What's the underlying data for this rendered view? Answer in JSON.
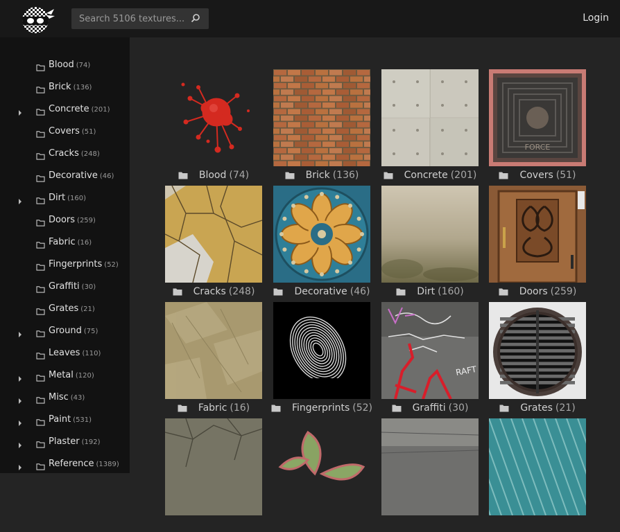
{
  "header": {
    "search_placeholder": "Search 5106 textures...",
    "login_label": "Login",
    "logo_icon": "ninja-checker-logo-icon"
  },
  "sidebar": {
    "items": [
      {
        "label": "Blood",
        "count": "(74)",
        "expandable": false
      },
      {
        "label": "Brick",
        "count": "(136)",
        "expandable": false
      },
      {
        "label": "Concrete",
        "count": "(201)",
        "expandable": true
      },
      {
        "label": "Covers",
        "count": "(51)",
        "expandable": false
      },
      {
        "label": "Cracks",
        "count": "(248)",
        "expandable": false
      },
      {
        "label": "Decorative",
        "count": "(46)",
        "expandable": false
      },
      {
        "label": "Dirt",
        "count": "(160)",
        "expandable": true
      },
      {
        "label": "Doors",
        "count": "(259)",
        "expandable": false
      },
      {
        "label": "Fabric",
        "count": "(16)",
        "expandable": false
      },
      {
        "label": "Fingerprints",
        "count": "(52)",
        "expandable": false
      },
      {
        "label": "Graffiti",
        "count": "(30)",
        "expandable": false
      },
      {
        "label": "Grates",
        "count": "(21)",
        "expandable": false
      },
      {
        "label": "Ground",
        "count": "(75)",
        "expandable": true
      },
      {
        "label": "Leaves",
        "count": "(110)",
        "expandable": false
      },
      {
        "label": "Metal",
        "count": "(120)",
        "expandable": true
      },
      {
        "label": "Misc",
        "count": "(43)",
        "expandable": true
      },
      {
        "label": "Paint",
        "count": "(531)",
        "expandable": true
      },
      {
        "label": "Plaster",
        "count": "(192)",
        "expandable": true
      },
      {
        "label": "Reference",
        "count": "(1389)",
        "expandable": true
      }
    ]
  },
  "grid": {
    "tiles": [
      {
        "label": "Blood",
        "count": "(74)",
        "texture": "blood"
      },
      {
        "label": "Brick",
        "count": "(136)",
        "texture": "brick"
      },
      {
        "label": "Concrete",
        "count": "(201)",
        "texture": "concrete"
      },
      {
        "label": "Covers",
        "count": "(51)",
        "texture": "covers"
      },
      {
        "label": "Cracks",
        "count": "(248)",
        "texture": "cracks"
      },
      {
        "label": "Decorative",
        "count": "(46)",
        "texture": "decorative"
      },
      {
        "label": "Dirt",
        "count": "(160)",
        "texture": "dirt"
      },
      {
        "label": "Doors",
        "count": "(259)",
        "texture": "doors"
      },
      {
        "label": "Fabric",
        "count": "(16)",
        "texture": "fabric"
      },
      {
        "label": "Fingerprints",
        "count": "(52)",
        "texture": "fingerprints"
      },
      {
        "label": "Graffiti",
        "count": "(30)",
        "texture": "graffiti"
      },
      {
        "label": "Grates",
        "count": "(21)",
        "texture": "grates"
      },
      {
        "label": "",
        "count": "",
        "texture": "ground"
      },
      {
        "label": "",
        "count": "",
        "texture": "leaves"
      },
      {
        "label": "",
        "count": "",
        "texture": "metal"
      },
      {
        "label": "",
        "count": "",
        "texture": "misc"
      }
    ]
  },
  "colors": {
    "topbar": "#181818",
    "sidebar": "#121212",
    "main": "#242424",
    "search_bg": "#333333",
    "folder_icon": "#c8c8c8"
  }
}
